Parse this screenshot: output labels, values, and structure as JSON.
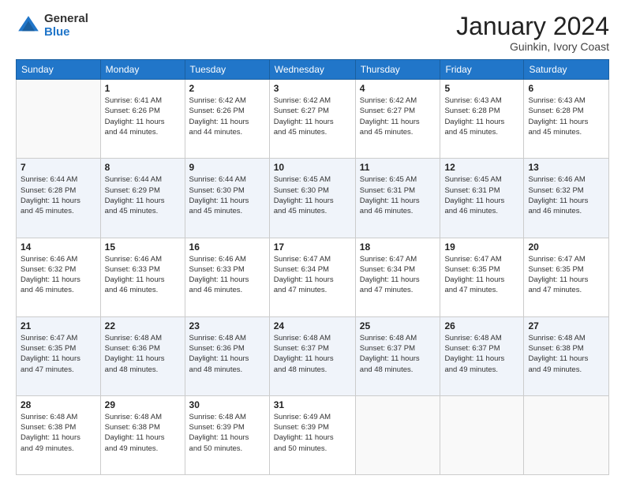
{
  "logo": {
    "general": "General",
    "blue": "Blue"
  },
  "header": {
    "month": "January 2024",
    "location": "Guinkin, Ivory Coast"
  },
  "days_of_week": [
    "Sunday",
    "Monday",
    "Tuesday",
    "Wednesday",
    "Thursday",
    "Friday",
    "Saturday"
  ],
  "weeks": [
    [
      {
        "day": "",
        "info": ""
      },
      {
        "day": "1",
        "info": "Sunrise: 6:41 AM\nSunset: 6:26 PM\nDaylight: 11 hours\nand 44 minutes."
      },
      {
        "day": "2",
        "info": "Sunrise: 6:42 AM\nSunset: 6:26 PM\nDaylight: 11 hours\nand 44 minutes."
      },
      {
        "day": "3",
        "info": "Sunrise: 6:42 AM\nSunset: 6:27 PM\nDaylight: 11 hours\nand 45 minutes."
      },
      {
        "day": "4",
        "info": "Sunrise: 6:42 AM\nSunset: 6:27 PM\nDaylight: 11 hours\nand 45 minutes."
      },
      {
        "day": "5",
        "info": "Sunrise: 6:43 AM\nSunset: 6:28 PM\nDaylight: 11 hours\nand 45 minutes."
      },
      {
        "day": "6",
        "info": "Sunrise: 6:43 AM\nSunset: 6:28 PM\nDaylight: 11 hours\nand 45 minutes."
      }
    ],
    [
      {
        "day": "7",
        "info": "Sunrise: 6:44 AM\nSunset: 6:28 PM\nDaylight: 11 hours\nand 45 minutes."
      },
      {
        "day": "8",
        "info": "Sunrise: 6:44 AM\nSunset: 6:29 PM\nDaylight: 11 hours\nand 45 minutes."
      },
      {
        "day": "9",
        "info": "Sunrise: 6:44 AM\nSunset: 6:30 PM\nDaylight: 11 hours\nand 45 minutes."
      },
      {
        "day": "10",
        "info": "Sunrise: 6:45 AM\nSunset: 6:30 PM\nDaylight: 11 hours\nand 45 minutes."
      },
      {
        "day": "11",
        "info": "Sunrise: 6:45 AM\nSunset: 6:31 PM\nDaylight: 11 hours\nand 46 minutes."
      },
      {
        "day": "12",
        "info": "Sunrise: 6:45 AM\nSunset: 6:31 PM\nDaylight: 11 hours\nand 46 minutes."
      },
      {
        "day": "13",
        "info": "Sunrise: 6:46 AM\nSunset: 6:32 PM\nDaylight: 11 hours\nand 46 minutes."
      }
    ],
    [
      {
        "day": "14",
        "info": "Sunrise: 6:46 AM\nSunset: 6:32 PM\nDaylight: 11 hours\nand 46 minutes."
      },
      {
        "day": "15",
        "info": "Sunrise: 6:46 AM\nSunset: 6:33 PM\nDaylight: 11 hours\nand 46 minutes."
      },
      {
        "day": "16",
        "info": "Sunrise: 6:46 AM\nSunset: 6:33 PM\nDaylight: 11 hours\nand 46 minutes."
      },
      {
        "day": "17",
        "info": "Sunrise: 6:47 AM\nSunset: 6:34 PM\nDaylight: 11 hours\nand 47 minutes."
      },
      {
        "day": "18",
        "info": "Sunrise: 6:47 AM\nSunset: 6:34 PM\nDaylight: 11 hours\nand 47 minutes."
      },
      {
        "day": "19",
        "info": "Sunrise: 6:47 AM\nSunset: 6:35 PM\nDaylight: 11 hours\nand 47 minutes."
      },
      {
        "day": "20",
        "info": "Sunrise: 6:47 AM\nSunset: 6:35 PM\nDaylight: 11 hours\nand 47 minutes."
      }
    ],
    [
      {
        "day": "21",
        "info": "Sunrise: 6:47 AM\nSunset: 6:35 PM\nDaylight: 11 hours\nand 47 minutes."
      },
      {
        "day": "22",
        "info": "Sunrise: 6:48 AM\nSunset: 6:36 PM\nDaylight: 11 hours\nand 48 minutes."
      },
      {
        "day": "23",
        "info": "Sunrise: 6:48 AM\nSunset: 6:36 PM\nDaylight: 11 hours\nand 48 minutes."
      },
      {
        "day": "24",
        "info": "Sunrise: 6:48 AM\nSunset: 6:37 PM\nDaylight: 11 hours\nand 48 minutes."
      },
      {
        "day": "25",
        "info": "Sunrise: 6:48 AM\nSunset: 6:37 PM\nDaylight: 11 hours\nand 48 minutes."
      },
      {
        "day": "26",
        "info": "Sunrise: 6:48 AM\nSunset: 6:37 PM\nDaylight: 11 hours\nand 49 minutes."
      },
      {
        "day": "27",
        "info": "Sunrise: 6:48 AM\nSunset: 6:38 PM\nDaylight: 11 hours\nand 49 minutes."
      }
    ],
    [
      {
        "day": "28",
        "info": "Sunrise: 6:48 AM\nSunset: 6:38 PM\nDaylight: 11 hours\nand 49 minutes."
      },
      {
        "day": "29",
        "info": "Sunrise: 6:48 AM\nSunset: 6:38 PM\nDaylight: 11 hours\nand 49 minutes."
      },
      {
        "day": "30",
        "info": "Sunrise: 6:48 AM\nSunset: 6:39 PM\nDaylight: 11 hours\nand 50 minutes."
      },
      {
        "day": "31",
        "info": "Sunrise: 6:49 AM\nSunset: 6:39 PM\nDaylight: 11 hours\nand 50 minutes."
      },
      {
        "day": "",
        "info": ""
      },
      {
        "day": "",
        "info": ""
      },
      {
        "day": "",
        "info": ""
      }
    ]
  ]
}
